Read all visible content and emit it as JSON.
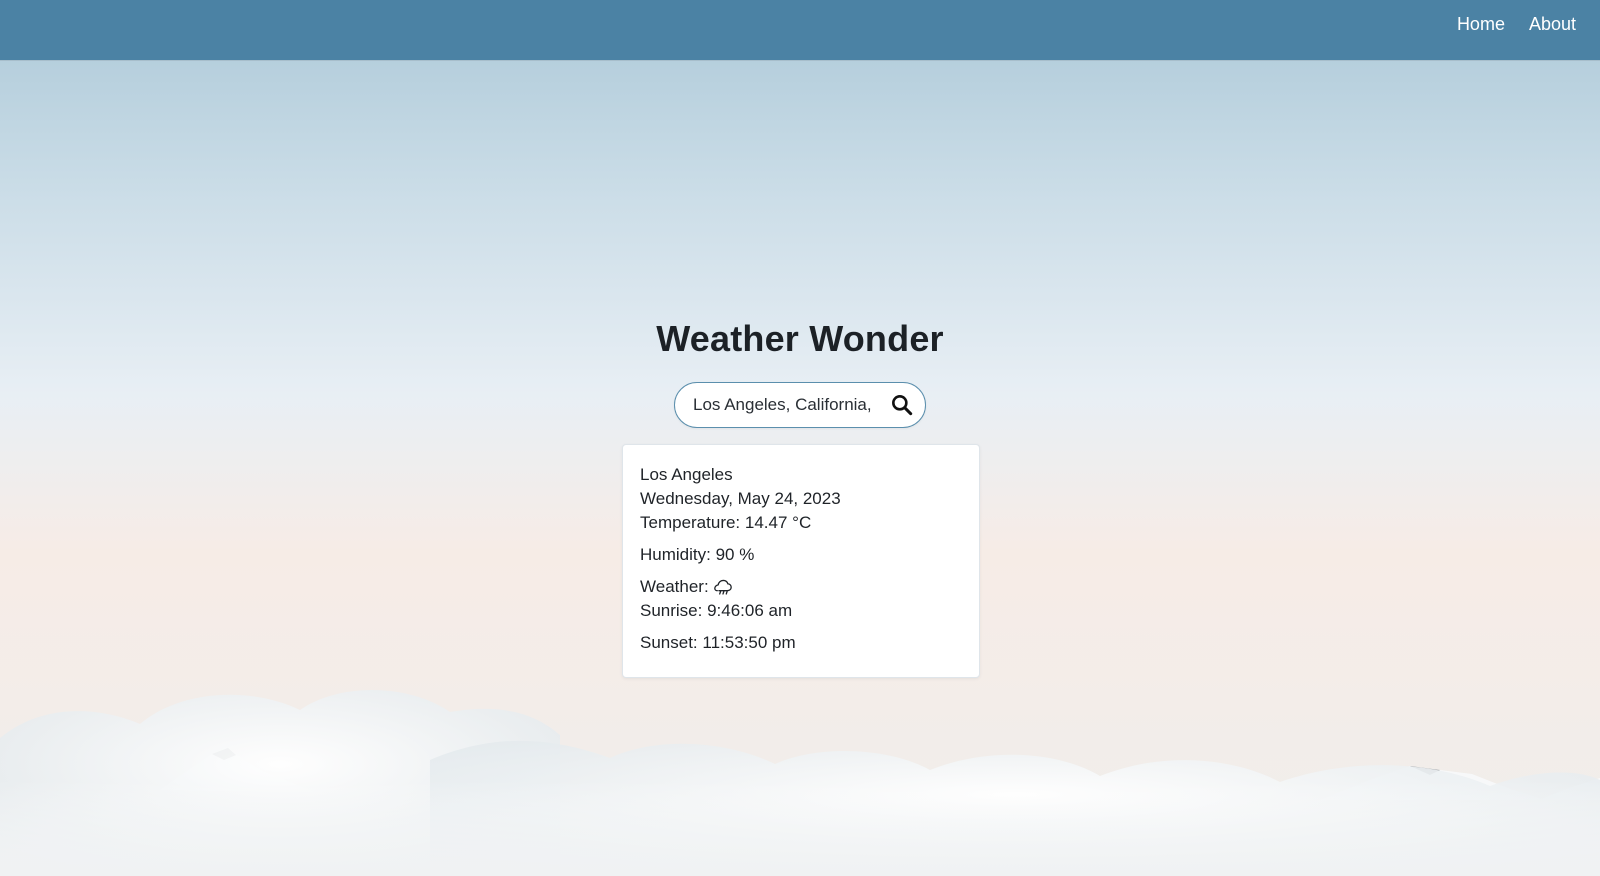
{
  "nav": {
    "items": [
      {
        "label": "Home"
      },
      {
        "label": "About"
      }
    ]
  },
  "main": {
    "title": "Weather Wonder",
    "search": {
      "value": "Los Angeles, California, United States",
      "placeholder": ""
    },
    "weather_card": {
      "city": "Los Angeles",
      "date": "Wednesday, May 24, 2023",
      "temperature": "Temperature: 14.47 °C",
      "humidity": "Humidity: 90 %",
      "weather_label": "Weather:",
      "weather_icon": "cloud-rain-icon",
      "sunrise": "Sunrise: 9:46:06 am",
      "sunset": "Sunset: 11:53:50 pm"
    }
  },
  "colors": {
    "topbar": "#4b82a4",
    "search_border": "#5b8fad",
    "text": "#1f2328",
    "card_bg": "#ffffff"
  }
}
